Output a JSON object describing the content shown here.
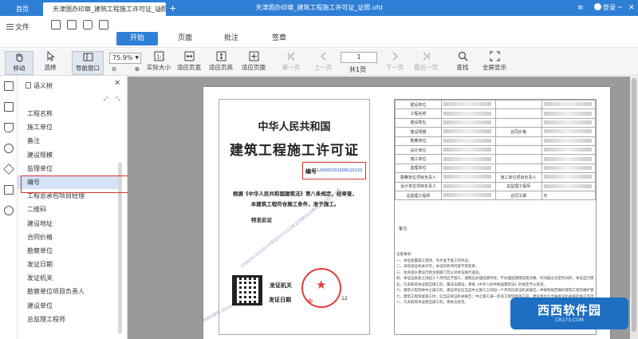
{
  "titlebar": {
    "tab_home": "首页",
    "tab_doc": "天津国办印章_建筑工程施工许可证_证照.ofd",
    "tab_add": "+",
    "window_title": "天津国办印章_建筑工程施工许可证_证照.ofd",
    "login_label": "登录",
    "minimize": "─",
    "maximize": "☐",
    "close": "✕"
  },
  "menubar": {
    "file_label": "文件",
    "tabs": [
      {
        "label": "开始",
        "active": true
      },
      {
        "label": "页面",
        "active": false
      },
      {
        "label": "批注",
        "active": false
      },
      {
        "label": "签章",
        "active": false
      }
    ]
  },
  "toolbar": {
    "move": "移动",
    "select": "选择",
    "nav_window": "导航窗口",
    "zoom_value": "75.9%",
    "actual_size": "实际大小",
    "fit_width": "适应页宽",
    "fit_height": "适应页高",
    "fit_page": "适应页面",
    "first_page": "第一页",
    "prev_page": "上一页",
    "page_current": "1",
    "page_total": "共1页",
    "next_page": "下一页",
    "last_page": "最后一页",
    "search": "查找",
    "fullscreen": "全屏显示"
  },
  "tree": {
    "title": "语义树",
    "items": [
      "工程名称",
      "施工单位",
      "备注",
      "建设规模",
      "监理单位",
      "编号",
      "工程总承包项目经理",
      "二维码",
      "建设地址",
      "合同价格",
      "勘察单位",
      "发证日期",
      "发证机关",
      "勘察单位项目负责人",
      "建设单位",
      "总监理工程师"
    ],
    "selected_index": 5
  },
  "certificate": {
    "title1": "中华人民共和国",
    "title2": "建筑工程施工许可证",
    "number_label": "编号",
    "number": "120000201906120120",
    "body_line1": "根据《中华人民共和国建筑法》第八条规定，经审查，",
    "body_line2": "本建筑工程符合施工条件，准予施工。",
    "special": "特发此证",
    "issuer_label": "发证机关",
    "date_label": "发证日期",
    "day": "12",
    "seal_text": "中",
    "watermark1": "200904170140129号出[2019]12发证日期2019年06月12日 二十签",
    "watermark2": "仅供测试使用 20190612 施工许可证"
  },
  "info_table": {
    "rows": [
      [
        "建设单位",
        "",
        "",
        ""
      ],
      [
        "工程名称",
        "",
        "",
        ""
      ],
      [
        "建设地址",
        "",
        "",
        ""
      ],
      [
        "建设规模",
        "",
        "合同价格",
        ""
      ],
      [
        "勘察单位",
        "",
        "",
        ""
      ],
      [
        "设计单位",
        "",
        "",
        ""
      ],
      [
        "施工单位",
        "",
        "",
        ""
      ],
      [
        "监理单位",
        "",
        "",
        ""
      ],
      [
        "勘察单位项目负责人",
        "",
        "施工单位项目负责人",
        ""
      ],
      [
        "设计单位项目负责人",
        "",
        "总监理工程师",
        ""
      ],
      [
        "总监理工程师",
        "",
        "合同工期",
        "天"
      ]
    ],
    "remarks_label": "备注:",
    "notes": [
      "注意事项：",
      "一、本证放置施工现场，作为准予施工的凭证。",
      "二、未经发证机关许可，本证的各项内容不得变更。",
      "三、住房城乡建设行政主管部门可以对本证进行查验。",
      "四、本证自核发之日起三个月内应予施工，逾期应办理延期手续，不办理延期或延期次数、时间超过法定时间的，本证自行废止。",
      "五、凡未取得本证擅自施工的，属违法建设，将按《中华人民共和国建筑法》的规定予以处罚。",
      "六、建筑工程因故中止施工的，建设单位应当自中止施工之日起一个月内向发证机关报告，并按照规定做好建筑工程的维护管理工作。",
      "七、建筑工程恢复施工时，应当向发证机关报告；中止施工满一年的工程恢复施工前，建设单位应当报发证机关核验施工许可证。",
      "八、凡未取得本证擅自施工的，将依法处罚。"
    ]
  },
  "badge": {
    "text": "西西软件园",
    "url": "CR173.COM"
  }
}
